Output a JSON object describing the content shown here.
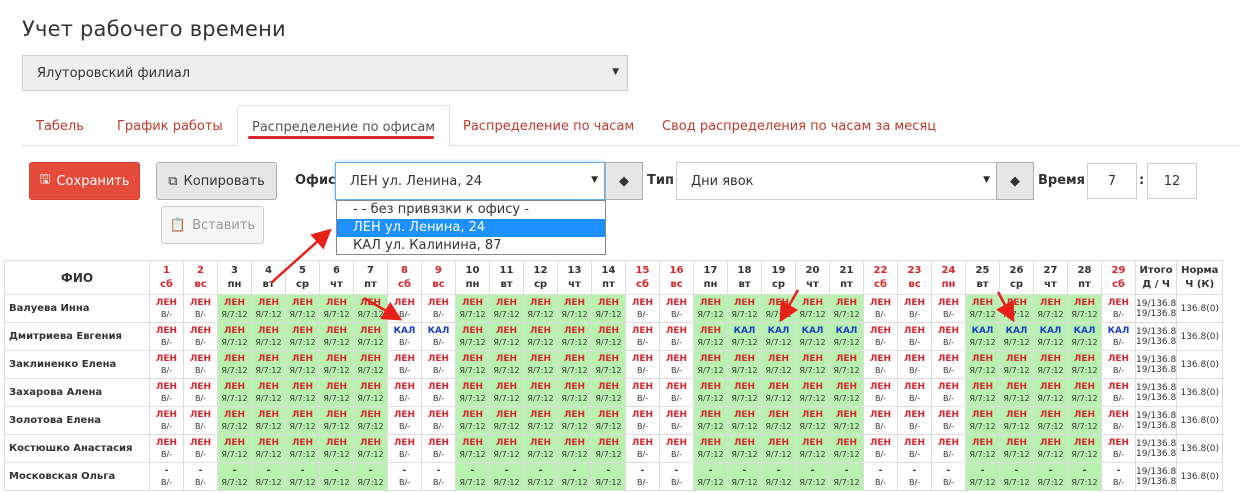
{
  "page": {
    "title": "Учет рабочего времени"
  },
  "branch": {
    "value": "Ялуторовский филиал"
  },
  "tabs": [
    {
      "label": "Табель"
    },
    {
      "label": "График работы"
    },
    {
      "label": "Распределение по офисам"
    },
    {
      "label": "Распределение по часам"
    },
    {
      "label": "Свод распределения по часам за месяц"
    }
  ],
  "toolbar": {
    "save_label": "Сохранить",
    "copy_label": "Копировать",
    "paste_label": "Вставить",
    "office_label": "Офис",
    "office_value": "ЛЕН ул. Ленина, 24",
    "type_label": "Тип",
    "type_value": "Дни явок",
    "time_label": "Время",
    "time_from": "7",
    "time_sep": ":",
    "time_to": "12"
  },
  "office_options": [
    "- - без привязки к офису -",
    "ЛЕН ул. Ленина, 24",
    "КАЛ ул. Калинина, 87"
  ],
  "office_selected_index": 1,
  "grid": {
    "fio_header": "ФИО",
    "total_header": [
      "Итого",
      "Д / Ч"
    ],
    "norm_header": [
      "Норма",
      "Ч (К)"
    ],
    "days": [
      {
        "n": "1",
        "d": "сб",
        "we": true
      },
      {
        "n": "2",
        "d": "вс",
        "we": true
      },
      {
        "n": "3",
        "d": "пн"
      },
      {
        "n": "4",
        "d": "вт"
      },
      {
        "n": "5",
        "d": "ср"
      },
      {
        "n": "6",
        "d": "чт"
      },
      {
        "n": "7",
        "d": "пт"
      },
      {
        "n": "8",
        "d": "сб",
        "we": true
      },
      {
        "n": "9",
        "d": "вс",
        "we": true
      },
      {
        "n": "10",
        "d": "пн"
      },
      {
        "n": "11",
        "d": "вт"
      },
      {
        "n": "12",
        "d": "ср"
      },
      {
        "n": "13",
        "d": "чт"
      },
      {
        "n": "14",
        "d": "пт"
      },
      {
        "n": "15",
        "d": "сб",
        "we": true
      },
      {
        "n": "16",
        "d": "вс",
        "we": true
      },
      {
        "n": "17",
        "d": "пн"
      },
      {
        "n": "18",
        "d": "вт"
      },
      {
        "n": "19",
        "d": "ср"
      },
      {
        "n": "20",
        "d": "чт"
      },
      {
        "n": "21",
        "d": "пт"
      },
      {
        "n": "22",
        "d": "сб",
        "we": true
      },
      {
        "n": "23",
        "d": "вс",
        "we": true
      },
      {
        "n": "24",
        "d": "пн",
        "we": true
      },
      {
        "n": "25",
        "d": "вт"
      },
      {
        "n": "26",
        "d": "ср"
      },
      {
        "n": "27",
        "d": "чт"
      },
      {
        "n": "28",
        "d": "пт"
      },
      {
        "n": "29",
        "d": "сб",
        "we": true
      }
    ],
    "work_sub": "Я/7:12",
    "off_sub": "В/-",
    "total": [
      "19/136.8",
      "19/136.8"
    ],
    "norm": "136.8(0)",
    "employees": [
      {
        "name": "Валуева Инна",
        "kal": []
      },
      {
        "name": "Дмитриева Евгения",
        "kal": [
          8,
          9,
          18,
          19,
          20,
          21,
          25,
          26,
          27,
          28,
          29
        ]
      },
      {
        "name": "Заклиненко Елена",
        "kal": []
      },
      {
        "name": "Захарова Алена",
        "kal": []
      },
      {
        "name": "Золотова Елена",
        "kal": []
      },
      {
        "name": "Костюшко Анастасия",
        "kal": []
      },
      {
        "name": "Московская Ольга",
        "kal": [],
        "none": true
      }
    ],
    "office_codes": {
      "len": "ЛЕН",
      "kal": "КАЛ",
      "none": "-"
    },
    "colors": {
      "work": "#b9f2b0",
      "len": "#d9262d",
      "kal": "#1a3fc4"
    }
  }
}
